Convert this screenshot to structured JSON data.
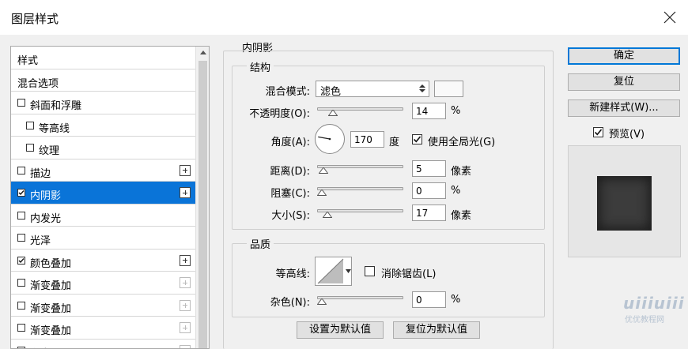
{
  "window": {
    "title": "图层样式"
  },
  "styles_list": {
    "header": "样式",
    "blend_options": "混合选项",
    "items": [
      {
        "label": "斜面和浮雕",
        "checked": false,
        "plus": "none"
      },
      {
        "label": "等高线",
        "checked": false,
        "plus": "none",
        "indent": true
      },
      {
        "label": "纹理",
        "checked": false,
        "plus": "none",
        "indent": true
      },
      {
        "label": "描边",
        "checked": false,
        "plus": "enabled"
      },
      {
        "label": "内阴影",
        "checked": true,
        "plus": "enabled",
        "selected": true
      },
      {
        "label": "内发光",
        "checked": false,
        "plus": "none"
      },
      {
        "label": "光泽",
        "checked": false,
        "plus": "none"
      },
      {
        "label": "颜色叠加",
        "checked": true,
        "plus": "enabled"
      },
      {
        "label": "渐变叠加",
        "checked": false,
        "plus": "disabled"
      },
      {
        "label": "渐变叠加",
        "checked": false,
        "plus": "disabled"
      },
      {
        "label": "渐变叠加",
        "checked": false,
        "plus": "disabled"
      },
      {
        "label": "渐变叠加",
        "checked": false,
        "plus": "disabled"
      }
    ]
  },
  "inner_shadow": {
    "section_title": "内阴影",
    "structure": {
      "title": "结构",
      "blend_mode_label": "混合模式:",
      "blend_mode_value": "滤色",
      "opacity_label": "不透明度(O):",
      "opacity_value": "14",
      "opacity_unit": "%",
      "opacity_level_pct": 14,
      "angle_label": "角度(A):",
      "angle_value": "170",
      "angle_unit": "度",
      "use_global_light_label": "使用全局光(G)",
      "use_global_light_checked": true,
      "distance_label": "距离(D):",
      "distance_value": "5",
      "distance_unit": "像素",
      "choke_label": "阻塞(C):",
      "choke_value": "0",
      "choke_unit": "%",
      "size_label": "大小(S):",
      "size_value": "17",
      "size_unit": "像素"
    },
    "quality": {
      "title": "品质",
      "contour_label": "等高线:",
      "anti_aliased_label": "消除锯齿(L)",
      "anti_aliased_checked": false,
      "noise_label": "杂色(N):",
      "noise_value": "0",
      "noise_unit": "%"
    },
    "make_default_label": "设置为默认值",
    "reset_default_label": "复位为默认值"
  },
  "buttons": {
    "ok": "确定",
    "reset": "复位",
    "new_style": "新建样式(W)...",
    "preview_label": "预览(V)",
    "preview_checked": true
  },
  "watermark": {
    "logo": "uiiiuiii",
    "text": "优优教程网"
  },
  "colors": {
    "selection": "#0a74d8",
    "preview_fill": "#3c3c3c"
  }
}
